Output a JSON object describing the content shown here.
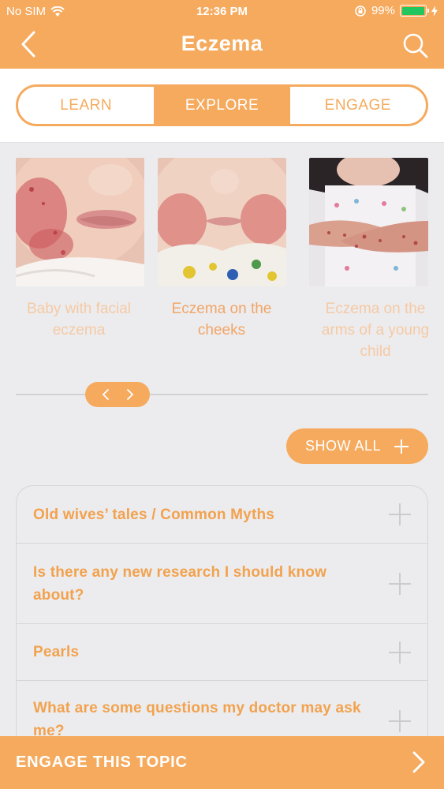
{
  "status_bar": {
    "carrier": "No SIM",
    "time": "12:36 PM",
    "battery": "99%",
    "wifi_icon": "wifi-icon",
    "lock_icon": "orientation-lock-icon",
    "battery_icon": "battery-icon",
    "charging_icon": "charging-bolt-icon"
  },
  "nav": {
    "title": "Eczema",
    "back_icon": "chevron-left-icon",
    "search_icon": "search-icon"
  },
  "tabs": [
    {
      "label": "LEARN",
      "active": false
    },
    {
      "label": "EXPLORE",
      "active": true
    },
    {
      "label": "ENGAGE",
      "active": false
    }
  ],
  "carousel": {
    "items": [
      {
        "caption_line1": "Baby with facial",
        "caption_line2": "eczema"
      },
      {
        "caption_line1": "Eczema on the",
        "caption_line2": "cheeks"
      },
      {
        "caption_line1": "Eczema on the",
        "caption_line2": "arms of a young",
        "caption_line3": "child"
      }
    ],
    "prev_icon": "chevron-left-icon",
    "next_icon": "chevron-right-icon"
  },
  "show_all": {
    "label": "SHOW ALL",
    "icon": "plus-icon"
  },
  "accordion": [
    {
      "label": "Old wives’ tales / Common Myths"
    },
    {
      "label": "Is there any new research I should know about?"
    },
    {
      "label": "Pearls"
    },
    {
      "label": "What are some questions my doctor may ask me?"
    }
  ],
  "bottom_bar": {
    "label": "ENGAGE THIS TOPIC",
    "icon": "chevron-right-icon"
  },
  "colors": {
    "accent": "#f5aa5e",
    "background": "#ececee"
  }
}
